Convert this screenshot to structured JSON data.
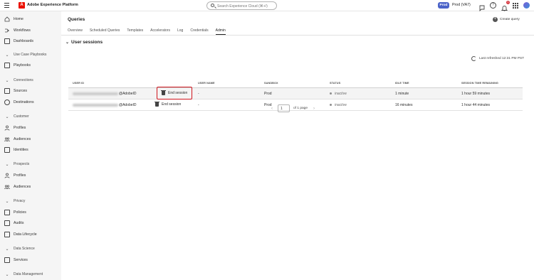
{
  "app": {
    "name": "Adobe Experience Platform",
    "logo_letter": "A"
  },
  "search": {
    "placeholder": "Search Experience Cloud (⌘+/)"
  },
  "header": {
    "sandbox_pill": "Prod",
    "sandbox_label": "Prod (VA7)",
    "notification_count": "1"
  },
  "sidebar": {
    "items": [
      {
        "label": "Home",
        "icon": "home-icon"
      },
      {
        "label": "Workflows",
        "icon": "workflows-icon"
      },
      {
        "label": "Dashboards",
        "icon": "dashboards-icon"
      }
    ],
    "sections": [
      {
        "label": "Use Case Playbooks",
        "items": [
          {
            "label": "Playbooks",
            "icon": "playbooks-icon"
          }
        ]
      },
      {
        "label": "Connections",
        "items": [
          {
            "label": "Sources",
            "icon": "sources-icon"
          },
          {
            "label": "Destinations",
            "icon": "destinations-icon"
          }
        ]
      },
      {
        "label": "Customer",
        "items": [
          {
            "label": "Profiles",
            "icon": "profiles-icon"
          },
          {
            "label": "Audiences",
            "icon": "audiences-icon"
          },
          {
            "label": "Identities",
            "icon": "identities-icon"
          }
        ]
      },
      {
        "label": "Prospects",
        "items": [
          {
            "label": "Profiles",
            "icon": "profiles-icon"
          },
          {
            "label": "Audiences",
            "icon": "audiences-icon"
          }
        ]
      },
      {
        "label": "Privacy",
        "items": [
          {
            "label": "Policies",
            "icon": "policies-icon"
          },
          {
            "label": "Audits",
            "icon": "audits-icon"
          },
          {
            "label": "Data Lifecycle",
            "icon": "data-lifecycle-icon"
          }
        ]
      },
      {
        "label": "Data Science",
        "items": [
          {
            "label": "Services",
            "icon": "services-icon"
          }
        ]
      },
      {
        "label": "Data Management",
        "items": []
      }
    ]
  },
  "main": {
    "title": "Queries",
    "create_label": "Create query",
    "tabs": [
      {
        "label": "Overview",
        "active": false
      },
      {
        "label": "Scheduled Queries",
        "active": false
      },
      {
        "label": "Templates",
        "active": false
      },
      {
        "label": "Accelerators",
        "active": false
      },
      {
        "label": "Log",
        "active": false
      },
      {
        "label": "Credentials",
        "active": false
      },
      {
        "label": "Admin",
        "active": true
      }
    ],
    "section_title": "User sessions",
    "last_refreshed": "Last refreshed 12:31 PM PST",
    "table": {
      "headers": [
        "USER ID",
        "USER NAME",
        "SANDBOX",
        "STATUS",
        "IDLE TIME",
        "SESSION TIME REMAINING"
      ],
      "end_label": "End session",
      "rows": [
        {
          "user_id_suffix": "@AdobeID",
          "user_name": "-",
          "sandbox": "Prod",
          "status": "inactive",
          "idle": "1 minute",
          "remaining": "1 hour 59 minutes"
        },
        {
          "user_id_suffix": "@AdobeID",
          "user_name": "-",
          "sandbox": "Prod",
          "status": "inactive",
          "idle": "16 minutes",
          "remaining": "1 hour 44 minutes"
        }
      ]
    },
    "pager": {
      "page": "1",
      "of_label": "of 1 page"
    }
  }
}
